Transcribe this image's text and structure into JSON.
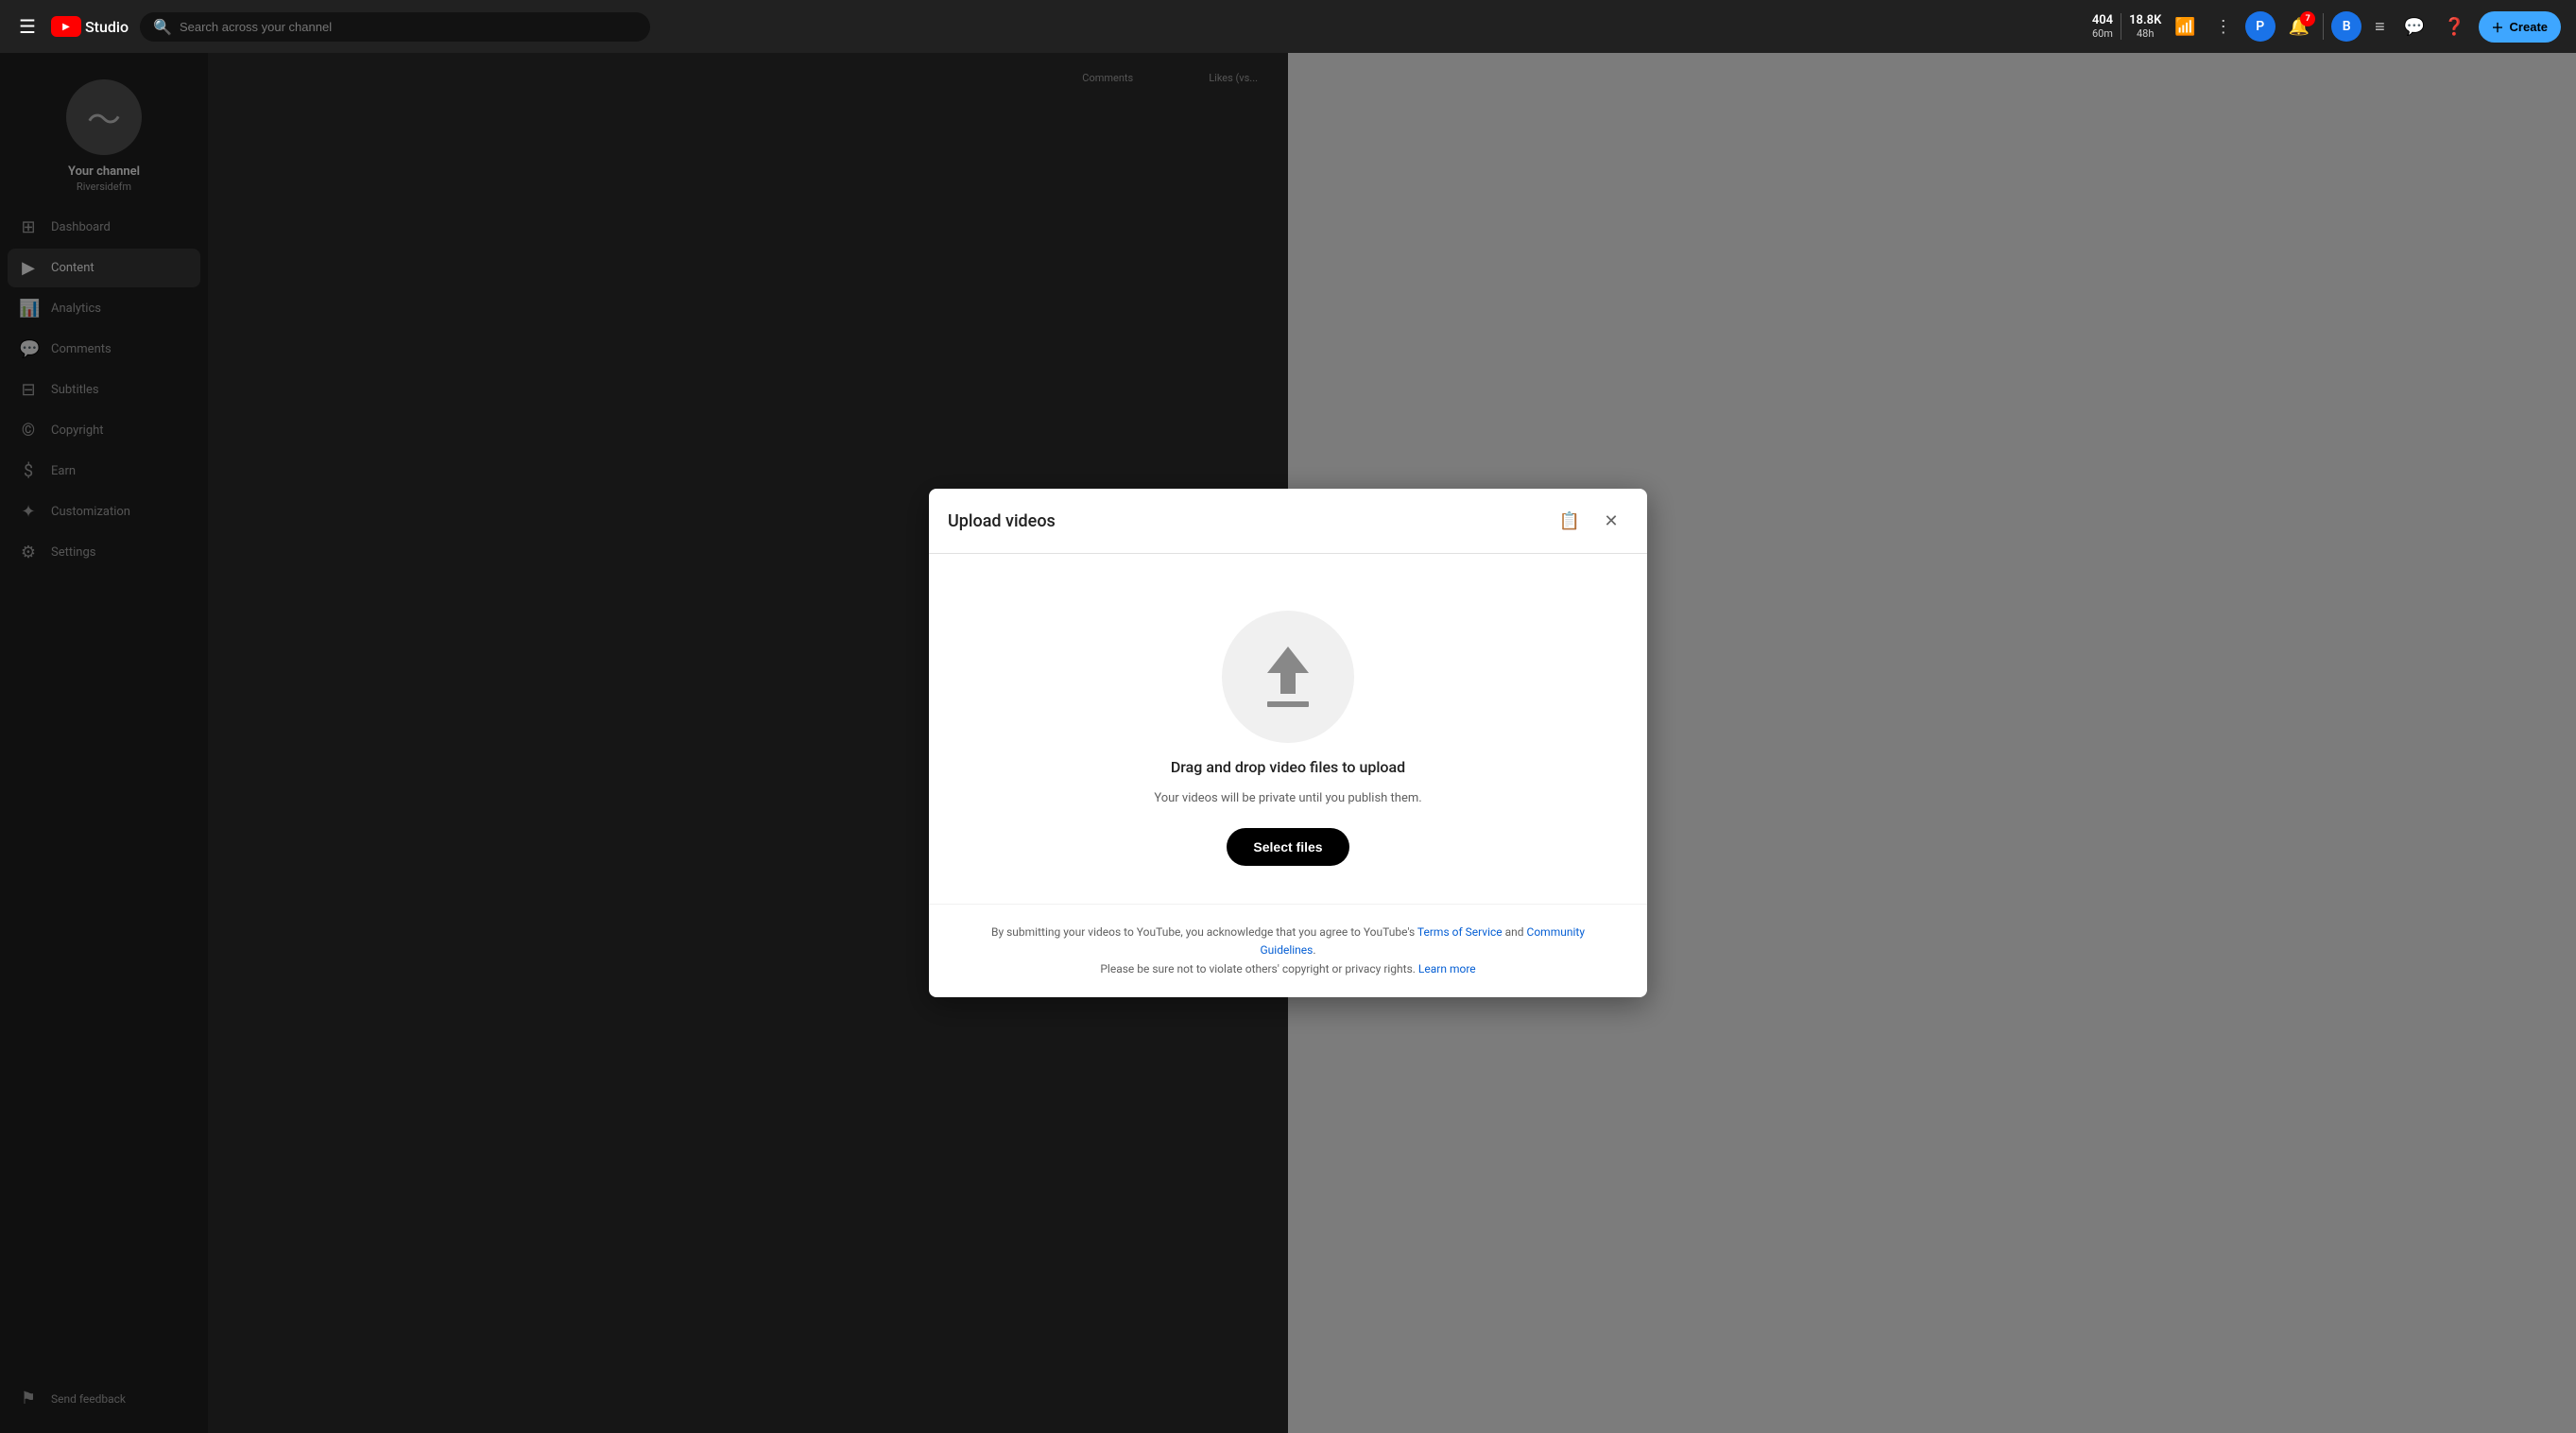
{
  "header": {
    "menu_icon": "☰",
    "logo_text": "Studio",
    "search_placeholder": "Search across your channel",
    "stats": [
      {
        "label": "60m",
        "value": "404"
      },
      {
        "label": "48h",
        "value": "18.8K"
      }
    ],
    "notifications_count": "7",
    "create_label": "Create"
  },
  "sidebar": {
    "channel_name": "Your channel",
    "channel_handle": "Riversidefm",
    "nav_items": [
      {
        "id": "dashboard",
        "icon": "⊞",
        "label": "Dashboard"
      },
      {
        "id": "content",
        "icon": "▶",
        "label": "Content",
        "active": true
      },
      {
        "id": "analytics",
        "icon": "📊",
        "label": "Analytics"
      },
      {
        "id": "comments",
        "icon": "💬",
        "label": "Comments"
      },
      {
        "id": "subtitles",
        "icon": "⊟",
        "label": "Subtitles"
      },
      {
        "id": "copyright",
        "icon": "©",
        "label": "Copyright"
      },
      {
        "id": "earn",
        "icon": "$",
        "label": "Earn"
      },
      {
        "id": "customization",
        "icon": "✦",
        "label": "Customization"
      },
      {
        "id": "settings",
        "icon": "⚙",
        "label": "Settings"
      }
    ],
    "footer_items": [
      {
        "id": "send-feedback",
        "icon": "⚑",
        "label": "Send feedback"
      }
    ]
  },
  "modal": {
    "title": "Upload videos",
    "drag_drop_text": "Drag and drop video files to upload",
    "privacy_text": "Your videos will be private until you publish them.",
    "select_files_label": "Select files",
    "footer_text_1": "By submitting your videos to YouTube, you acknowledge that you agree to YouTube's ",
    "footer_tos_label": "Terms of Service",
    "footer_and": " and ",
    "footer_community_label": "Community Guidelines",
    "footer_text_2": ".",
    "footer_text_3": "Please be sure not to violate others' copyright or privacy rights. ",
    "footer_learn_more_label": "Learn more"
  },
  "bg_columns": [
    "Comments",
    "Likes (vs..."
  ]
}
